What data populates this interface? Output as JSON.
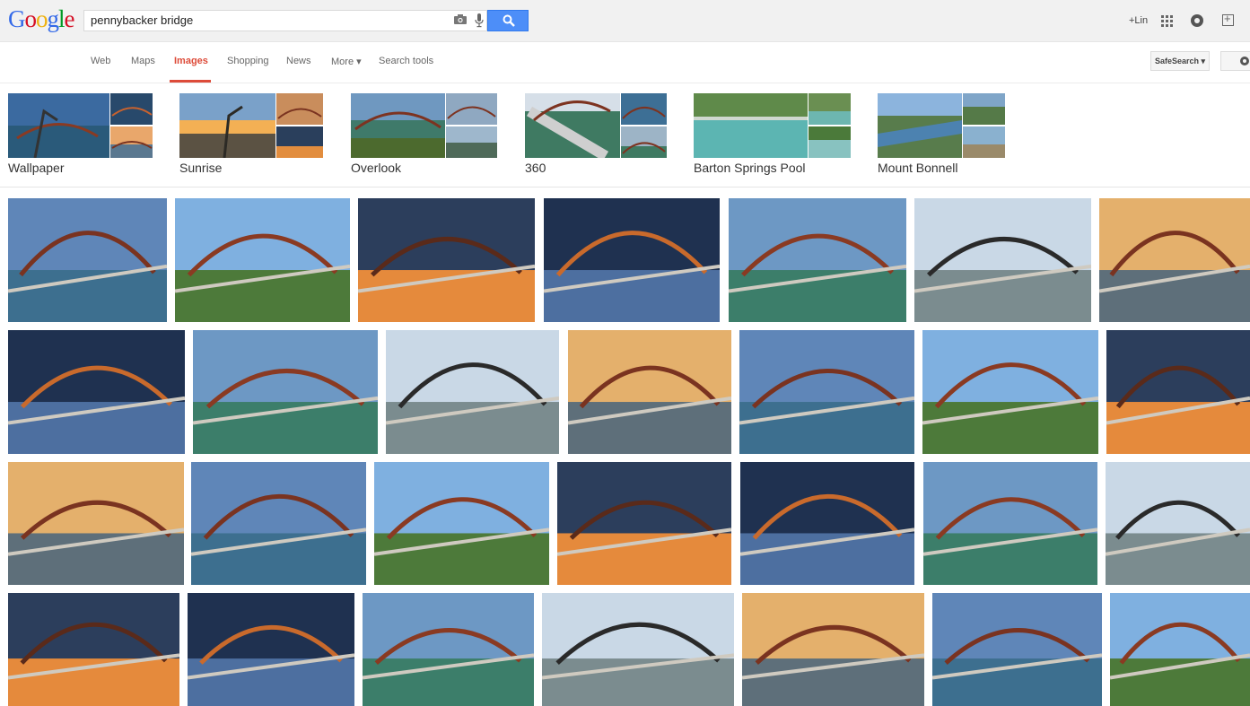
{
  "header": {
    "logo_letters": [
      "G",
      "o",
      "o",
      "g",
      "l",
      "e"
    ],
    "logo_colors": [
      "#3369e8",
      "#d50f25",
      "#eeb211",
      "#3369e8",
      "#009925",
      "#d50f25"
    ],
    "search_value": "pennybacker bridge",
    "user_label": "+Lin"
  },
  "nav": {
    "items": [
      "Web",
      "Maps",
      "Images",
      "Shopping",
      "News",
      "More",
      "Search tools"
    ],
    "active": "Images",
    "more_label": "More ▾",
    "safesearch_label": "SafeSearch ▾"
  },
  "related": [
    {
      "label": "Wallpaper"
    },
    {
      "label": "Sunrise"
    },
    {
      "label": "Overlook"
    },
    {
      "label": "360"
    },
    {
      "label": "Barton Springs Pool"
    },
    {
      "label": "Mount Bonnell"
    }
  ],
  "colors": {
    "accent": "#dd4b39",
    "search_button": "#4d8ef8",
    "sky_blue": "#4a86c8",
    "water_green": "#3f8f6a",
    "bridge_red": "#8a3a22",
    "sunset_orange": "#e98b3a"
  }
}
